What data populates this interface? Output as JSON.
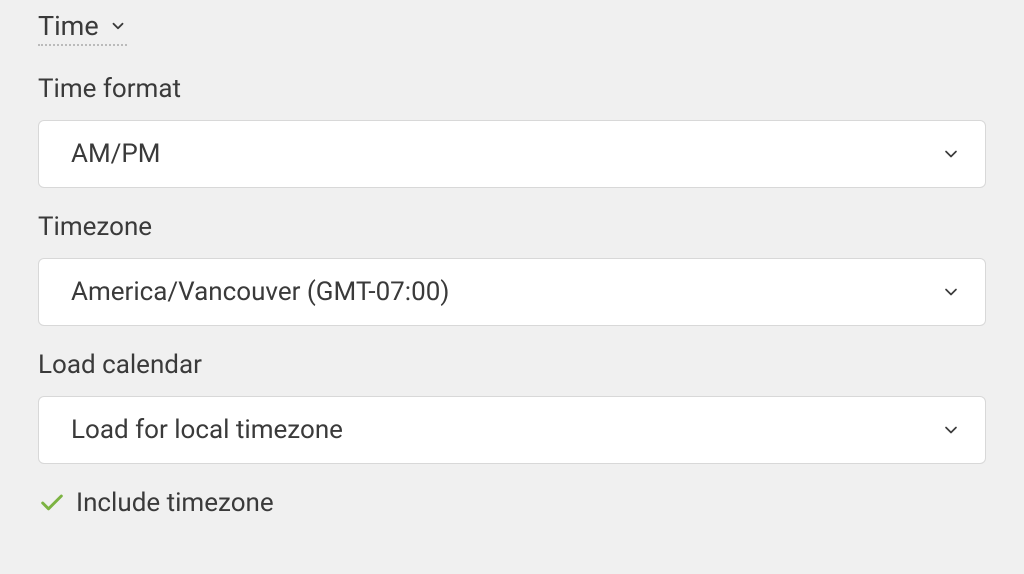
{
  "section": {
    "title": "Time"
  },
  "fields": {
    "time_format": {
      "label": "Time format",
      "value": "AM/PM"
    },
    "timezone": {
      "label": "Timezone",
      "value": "America/Vancouver (GMT-07:00)"
    },
    "load_calendar": {
      "label": "Load calendar",
      "value": "Load for local timezone"
    }
  },
  "checkbox": {
    "include_timezone_label": "Include timezone",
    "checked": true
  },
  "colors": {
    "accent": "#7cb342"
  }
}
